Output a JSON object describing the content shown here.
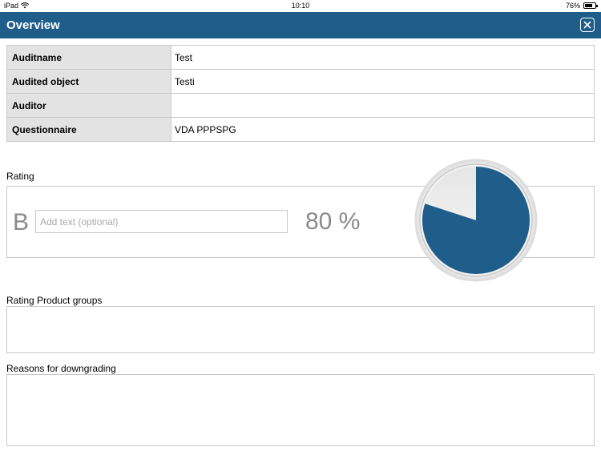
{
  "status_bar": {
    "device": "iPad",
    "time": "10:10",
    "battery": "76%",
    "battery_level": 0.76
  },
  "navbar": {
    "title": "Overview",
    "close_icon": "close-icon"
  },
  "info": [
    {
      "label": "Auditname",
      "value": "Test"
    },
    {
      "label": "Audited object",
      "value": "Testi"
    },
    {
      "label": "Auditor",
      "value": ""
    },
    {
      "label": "Questionnaire",
      "value": "VDA PPPSPG"
    }
  ],
  "rating": {
    "label": "Rating",
    "grade": "B",
    "text_placeholder": "Add text (optional)",
    "text_value": "",
    "percent_text": "80 %",
    "percent_value": 80,
    "pie_color": "#1f5e8a"
  },
  "product_groups": {
    "label": "Rating Product groups"
  },
  "downgrading": {
    "label": "Reasons for downgrading"
  }
}
